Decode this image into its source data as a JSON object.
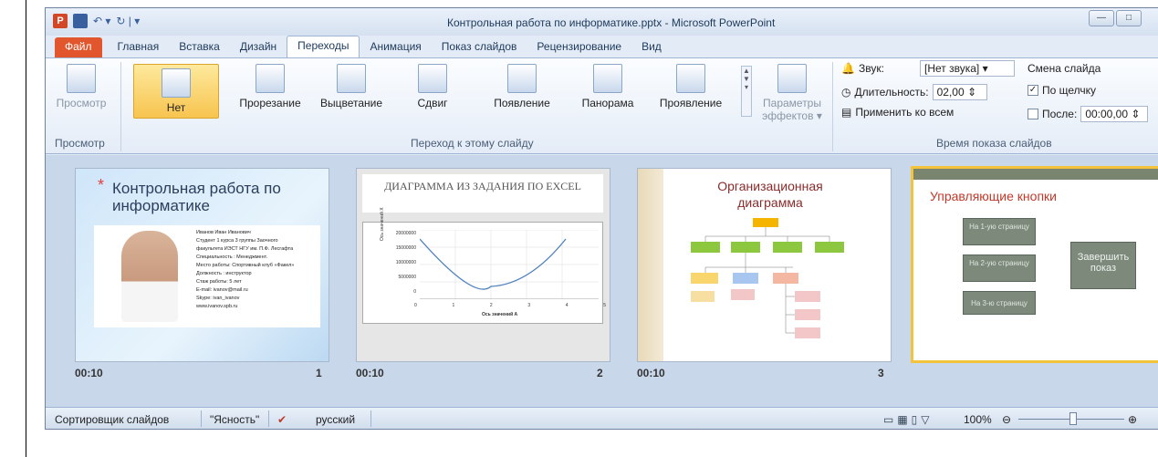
{
  "window": {
    "title": "Контрольная работа по информатике.pptx - Microsoft PowerPoint"
  },
  "qat": {
    "logo": "P",
    "undo": "↶ ▾",
    "redo": "↻ | ▾"
  },
  "tabs": [
    "Файл",
    "Главная",
    "Вставка",
    "Дизайн",
    "Переходы",
    "Анимация",
    "Показ слайдов",
    "Рецензирование",
    "Вид"
  ],
  "ribbon": {
    "preview_label": "Просмотр",
    "preview_group": "Просмотр",
    "transitions": [
      "Нет",
      "Прорезание",
      "Выцветание",
      "Сдвиг",
      "Появление",
      "Панорама",
      "Проявление"
    ],
    "effects_label_1": "Параметры",
    "effects_label_2": "эффектов ▾",
    "transition_group": "Переход к этому слайду",
    "sound_label": "Звук:",
    "sound_value": "[Нет звука]",
    "duration_label": "Длительность:",
    "duration_value": "02,00",
    "apply_all": "Применить ко всем",
    "advance_label": "Смена слайда",
    "on_click": "По щелчку",
    "after": "После:",
    "after_value": "00:00,00",
    "timing_group": "Время показа слайдов"
  },
  "slides": [
    {
      "time": "00:10",
      "num": "1",
      "title": "Контрольная работа по информатике",
      "lines": [
        "Иванов Иван Иванович",
        "Студент 1 курса 3 группы Заочного",
        "факультета ИЭСТ НГУ им. П.Ф. Лесгафта",
        "Специальность : Менеджмент.",
        "Место работы: Спортивный клуб «Факел»",
        "Должность : инструктор",
        "Стаж работы: 5 лет",
        "E-mail: ivanov@mail.ru",
        "Skype: ivan_ivanov",
        "www.ivanov.spb.ru"
      ]
    },
    {
      "time": "00:10",
      "num": "2",
      "title": "ДИАГРАММА ИЗ ЗАДАНИЯ ПО EXCEL",
      "yaxis": [
        "20000000",
        "15000000",
        "10000000",
        "5000000",
        "0"
      ],
      "xaxis": [
        "0",
        "1",
        "2",
        "3",
        "4",
        "5"
      ],
      "ylabel": "Ось значений Х",
      "xlabel": "Ось значений А"
    },
    {
      "time": "00:10",
      "num": "3",
      "title": "Организационная диаграмма"
    },
    {
      "title": "Управляющие кнопки",
      "buttons": [
        "На 1-ую страницу",
        "На 2-ую страницу",
        "На 3-ю страницу"
      ],
      "finish": "Завершить показ"
    }
  ],
  "status": {
    "view": "Сортировщик слайдов",
    "theme": "\"Ясность\"",
    "lang": "русский",
    "zoom": "100%"
  },
  "colors": {
    "accent": "#f7c44f",
    "file_tab": "#e2562e"
  }
}
